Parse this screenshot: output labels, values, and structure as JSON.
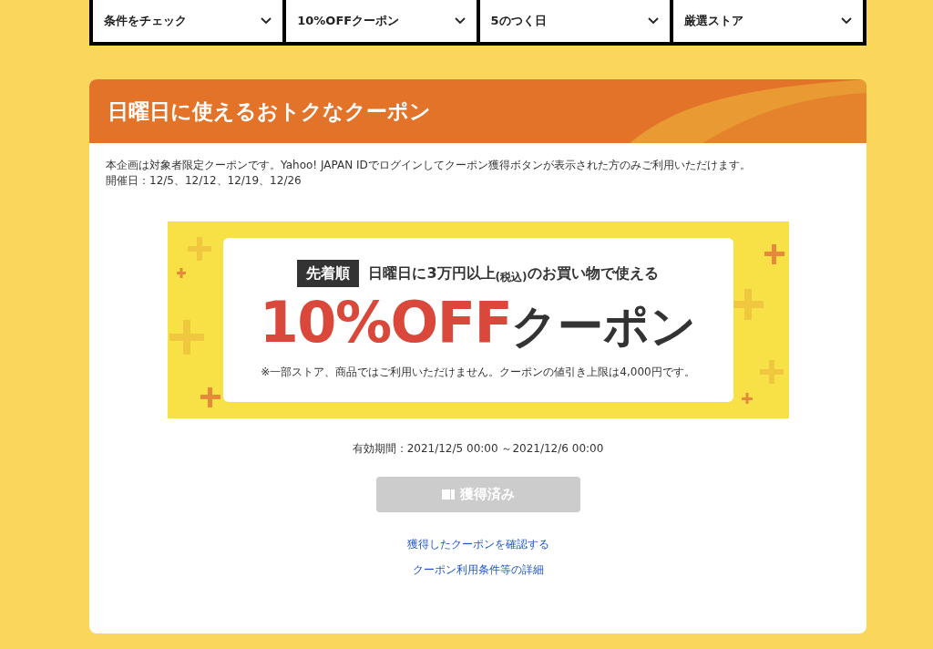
{
  "filters": [
    {
      "label": "条件をチェック",
      "expanded": false
    },
    {
      "label": "10%OFFクーポン",
      "expanded": false
    },
    {
      "label": "5のつく日",
      "expanded": false
    },
    {
      "label": "厳選ストア",
      "expanded": false
    }
  ],
  "card": {
    "title": "日曜日に使えるおトクなクーポン",
    "notice": "本企画は対象者限定クーポンです。Yahoo! JAPAN IDでログインしてクーポン獲得ボタンが表示された方のみご利用いただけます。",
    "dates": "開催日：12/5、12/12、12/19、12/26",
    "banner": {
      "badge": "先着順",
      "condition": "日曜日に3万円以上$_{(税込)}$のお買い物で使える",
      "discount": "10%OFF",
      "coupon_word": "クーポン",
      "note": "※一部ストア、商品ではご利用いただけません。クーポンの値引き上限は4,000円です。"
    },
    "validity": "有効期間：2021/12/5 00:00 ～2021/12/6 00:00",
    "button": {
      "label": "獲得済み",
      "disabled": true
    },
    "links": [
      "獲得したクーポンを確認する",
      "クーポン利用条件等の詳細"
    ]
  }
}
